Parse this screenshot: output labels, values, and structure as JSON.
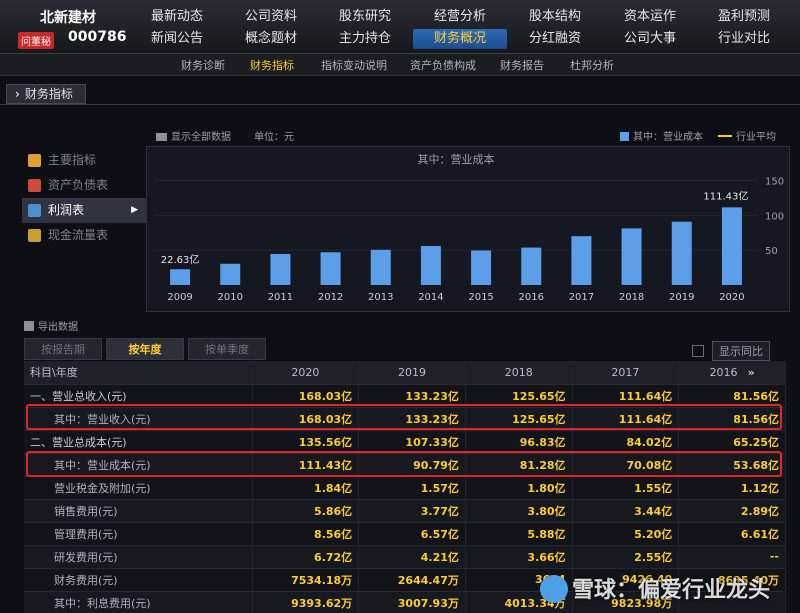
{
  "brand": {
    "name": "北新建材",
    "badge": "问董秘",
    "code": "000786"
  },
  "nav": {
    "row1": [
      "最新动态",
      "公司资料",
      "股东研究",
      "经营分析",
      "股本结构",
      "资本运作",
      "盈利预测"
    ],
    "row2": [
      "新闻公告",
      "概念题材",
      "主力持仓",
      "财务概况",
      "分红融资",
      "公司大事",
      "行业对比"
    ],
    "active": "财务概况"
  },
  "subnav": {
    "items": [
      "财务诊断",
      "财务指标",
      "指标变动说明",
      "资产负债构成",
      "财务报告",
      "杜邦分析"
    ],
    "active": "财务指标"
  },
  "section_title": "财务指标",
  "toolbar": {
    "show_all": "显示全部数据",
    "unit": "单位：元",
    "legend_bar": "其中：营业成本",
    "legend_line": "行业平均"
  },
  "sidemenu": [
    {
      "label": "主要指标",
      "icon": "star-icon",
      "active": false
    },
    {
      "label": "资产负债表",
      "icon": "balance-sheet-icon",
      "active": false
    },
    {
      "label": "利润表",
      "icon": "income-statement-icon",
      "active": true
    },
    {
      "label": "现金流量表",
      "icon": "cash-flow-icon",
      "active": false
    }
  ],
  "chart_data": {
    "type": "bar",
    "title": "其中：营业成本",
    "categories": [
      "2009",
      "2010",
      "2011",
      "2012",
      "2013",
      "2014",
      "2015",
      "2016",
      "2017",
      "2018",
      "2019",
      "2020"
    ],
    "series": [
      {
        "name": "其中：营业成本",
        "values": [
          22.63,
          30.5,
          44.5,
          47.0,
          50.5,
          56.0,
          49.5,
          53.68,
          70.08,
          81.28,
          90.79,
          111.43
        ]
      }
    ],
    "labels": {
      "first": "22.63亿",
      "last": "111.43亿"
    },
    "yticks": [
      50,
      100,
      150
    ],
    "ylim": [
      0,
      155
    ],
    "colors": {
      "bar": "#5c9ee8",
      "line": "#ffcc33"
    }
  },
  "export_label": "导出数据",
  "tabs": [
    "按报告期",
    "按年度",
    "按单季度"
  ],
  "active_tab": "按年度",
  "yoy": {
    "label": "显示同比"
  },
  "table": {
    "header": [
      "科目\\年度",
      "2020",
      "2019",
      "2018",
      "2017",
      "2016"
    ],
    "more_icon": "»",
    "rows": [
      {
        "label": "一、营业总收入(元)",
        "sub": false,
        "values": [
          "168.03亿",
          "133.23亿",
          "125.65亿",
          "111.64亿",
          "81.56亿"
        ]
      },
      {
        "label": "其中：营业收入(元)",
        "sub": true,
        "values": [
          "168.03亿",
          "133.23亿",
          "125.65亿",
          "111.64亿",
          "81.56亿"
        ]
      },
      {
        "label": "二、营业总成本(元)",
        "sub": false,
        "values": [
          "135.56亿",
          "107.33亿",
          "96.83亿",
          "84.02亿",
          "65.25亿"
        ]
      },
      {
        "label": "其中：营业成本(元)",
        "sub": true,
        "values": [
          "111.43亿",
          "90.79亿",
          "81.28亿",
          "70.08亿",
          "53.68亿"
        ]
      },
      {
        "label": "营业税金及附加(元)",
        "sub": true,
        "values": [
          "1.84亿",
          "1.57亿",
          "1.80亿",
          "1.55亿",
          "1.12亿"
        ]
      },
      {
        "label": "销售费用(元)",
        "sub": true,
        "values": [
          "5.86亿",
          "3.77亿",
          "3.80亿",
          "3.44亿",
          "2.89亿"
        ]
      },
      {
        "label": "管理费用(元)",
        "sub": true,
        "values": [
          "8.56亿",
          "6.57亿",
          "5.88亿",
          "5.20亿",
          "6.61亿"
        ]
      },
      {
        "label": "研发费用(元)",
        "sub": true,
        "values": [
          "6.72亿",
          "4.21亿",
          "3.66亿",
          "2.55亿",
          "--"
        ]
      },
      {
        "label": "财务费用(元)",
        "sub": true,
        "values": [
          "7534.18万",
          "2644.47万",
          "3624",
          "9426.40",
          "8635.40万"
        ]
      },
      {
        "label": "其中：利息费用(元)",
        "sub": true,
        "values": [
          "9393.62万",
          "3007.93万",
          "4013.34万",
          "9823.98万",
          ""
        ]
      }
    ]
  },
  "watermark": "雪球：偏爱行业龙头"
}
